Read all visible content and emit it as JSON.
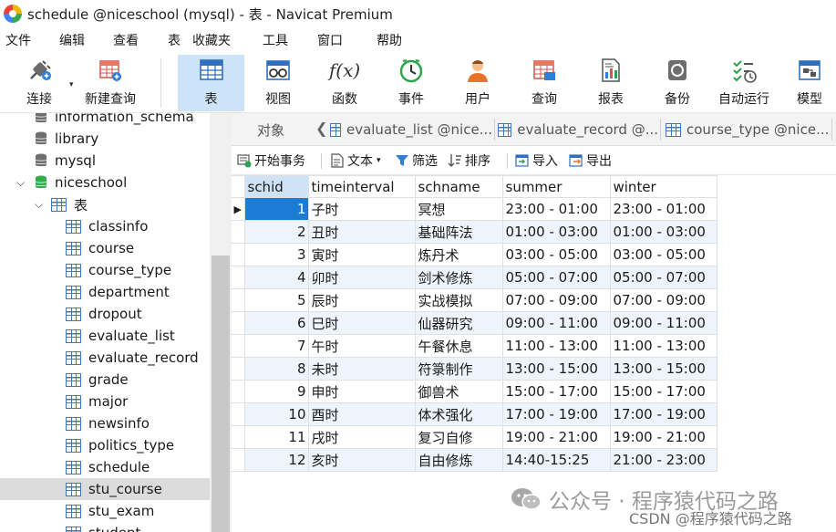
{
  "window": {
    "title": "schedule @niceschool (mysql) - 表 - Navicat Premium"
  },
  "menu": [
    "文件",
    "编辑",
    "查看",
    "表",
    "收藏夹",
    "工具",
    "窗口",
    "帮助"
  ],
  "toolbar": {
    "items": [
      {
        "label": "连接",
        "icon": "plug-icon"
      },
      {
        "label": "新建查询",
        "icon": "new-query-icon"
      },
      {
        "label": "表",
        "icon": "table-icon",
        "active": true
      },
      {
        "label": "视图",
        "icon": "view-icon"
      },
      {
        "label": "函数",
        "icon": "function-icon",
        "glyph": "f(x)"
      },
      {
        "label": "事件",
        "icon": "clock-icon"
      },
      {
        "label": "用户",
        "icon": "user-icon"
      },
      {
        "label": "查询",
        "icon": "query-icon"
      },
      {
        "label": "报表",
        "icon": "report-icon"
      },
      {
        "label": "备份",
        "icon": "backup-icon"
      },
      {
        "label": "自动运行",
        "icon": "autorun-icon"
      },
      {
        "label": "模型",
        "icon": "model-icon"
      }
    ]
  },
  "sidebar": {
    "databases": [
      "information_schema",
      "library",
      "mysql",
      "niceschool"
    ],
    "folder": "表",
    "tables": [
      "classinfo",
      "course",
      "course_type",
      "department",
      "dropout",
      "evaluate_list",
      "evaluate_record",
      "grade",
      "major",
      "newsinfo",
      "politics_type",
      "schedule",
      "stu_course",
      "stu_exam",
      "student"
    ],
    "selected": "stu_course"
  },
  "tabs": {
    "objects": "对象",
    "open": [
      "evaluate_list @nice...",
      "evaluate_record @...",
      "course_type @nice..."
    ]
  },
  "subtoolbar": {
    "begin_transaction": "开始事务",
    "text": "文本",
    "filter": "筛选",
    "sort": "排序",
    "import": "导入",
    "export": "导出"
  },
  "grid": {
    "columns": [
      "schid",
      "timeinterval",
      "schname",
      "summer",
      "winter"
    ],
    "rows": [
      [
        "1",
        "子时",
        "冥想",
        "23:00 - 01:00",
        "23:00 - 01:00"
      ],
      [
        "2",
        "丑时",
        "基础阵法",
        "01:00 - 03:00",
        "01:00 - 03:00"
      ],
      [
        "3",
        "寅时",
        "炼丹术",
        "03:00 - 05:00",
        "03:00 - 05:00"
      ],
      [
        "4",
        "卯时",
        "剑术修炼",
        "05:00 - 07:00",
        "05:00 - 07:00"
      ],
      [
        "5",
        "辰时",
        "实战模拟",
        "07:00 - 09:00",
        "07:00 - 09:00"
      ],
      [
        "6",
        "巳时",
        "仙器研究",
        "09:00 - 11:00",
        "09:00 - 11:00"
      ],
      [
        "7",
        "午时",
        "午餐休息",
        "11:00 - 13:00",
        "11:00 - 13:00"
      ],
      [
        "8",
        "未时",
        "符箓制作",
        "13:00 - 15:00",
        "13:00 - 15:00"
      ],
      [
        "9",
        "申时",
        "御兽术",
        "15:00 - 17:00",
        "15:00 - 17:00"
      ],
      [
        "10",
        "酉时",
        "体术强化",
        "17:00 - 19:00",
        "17:00 - 19:00"
      ],
      [
        "11",
        "戌时",
        "复习自修",
        "19:00 - 21:00",
        "19:00 - 21:00"
      ],
      [
        "12",
        "亥时",
        "自由修炼",
        "14:40-15:25",
        "21:00 - 23:00"
      ]
    ]
  },
  "watermark": {
    "text": "公众号 · 程序猿代码之路",
    "credit": "CSDN @程序猿代码之路"
  },
  "colors": {
    "accent": "#1c7cd5",
    "active_tool": "#cde3f7",
    "table_icon": "#3a78c3",
    "db_green": "#2fae4b"
  }
}
